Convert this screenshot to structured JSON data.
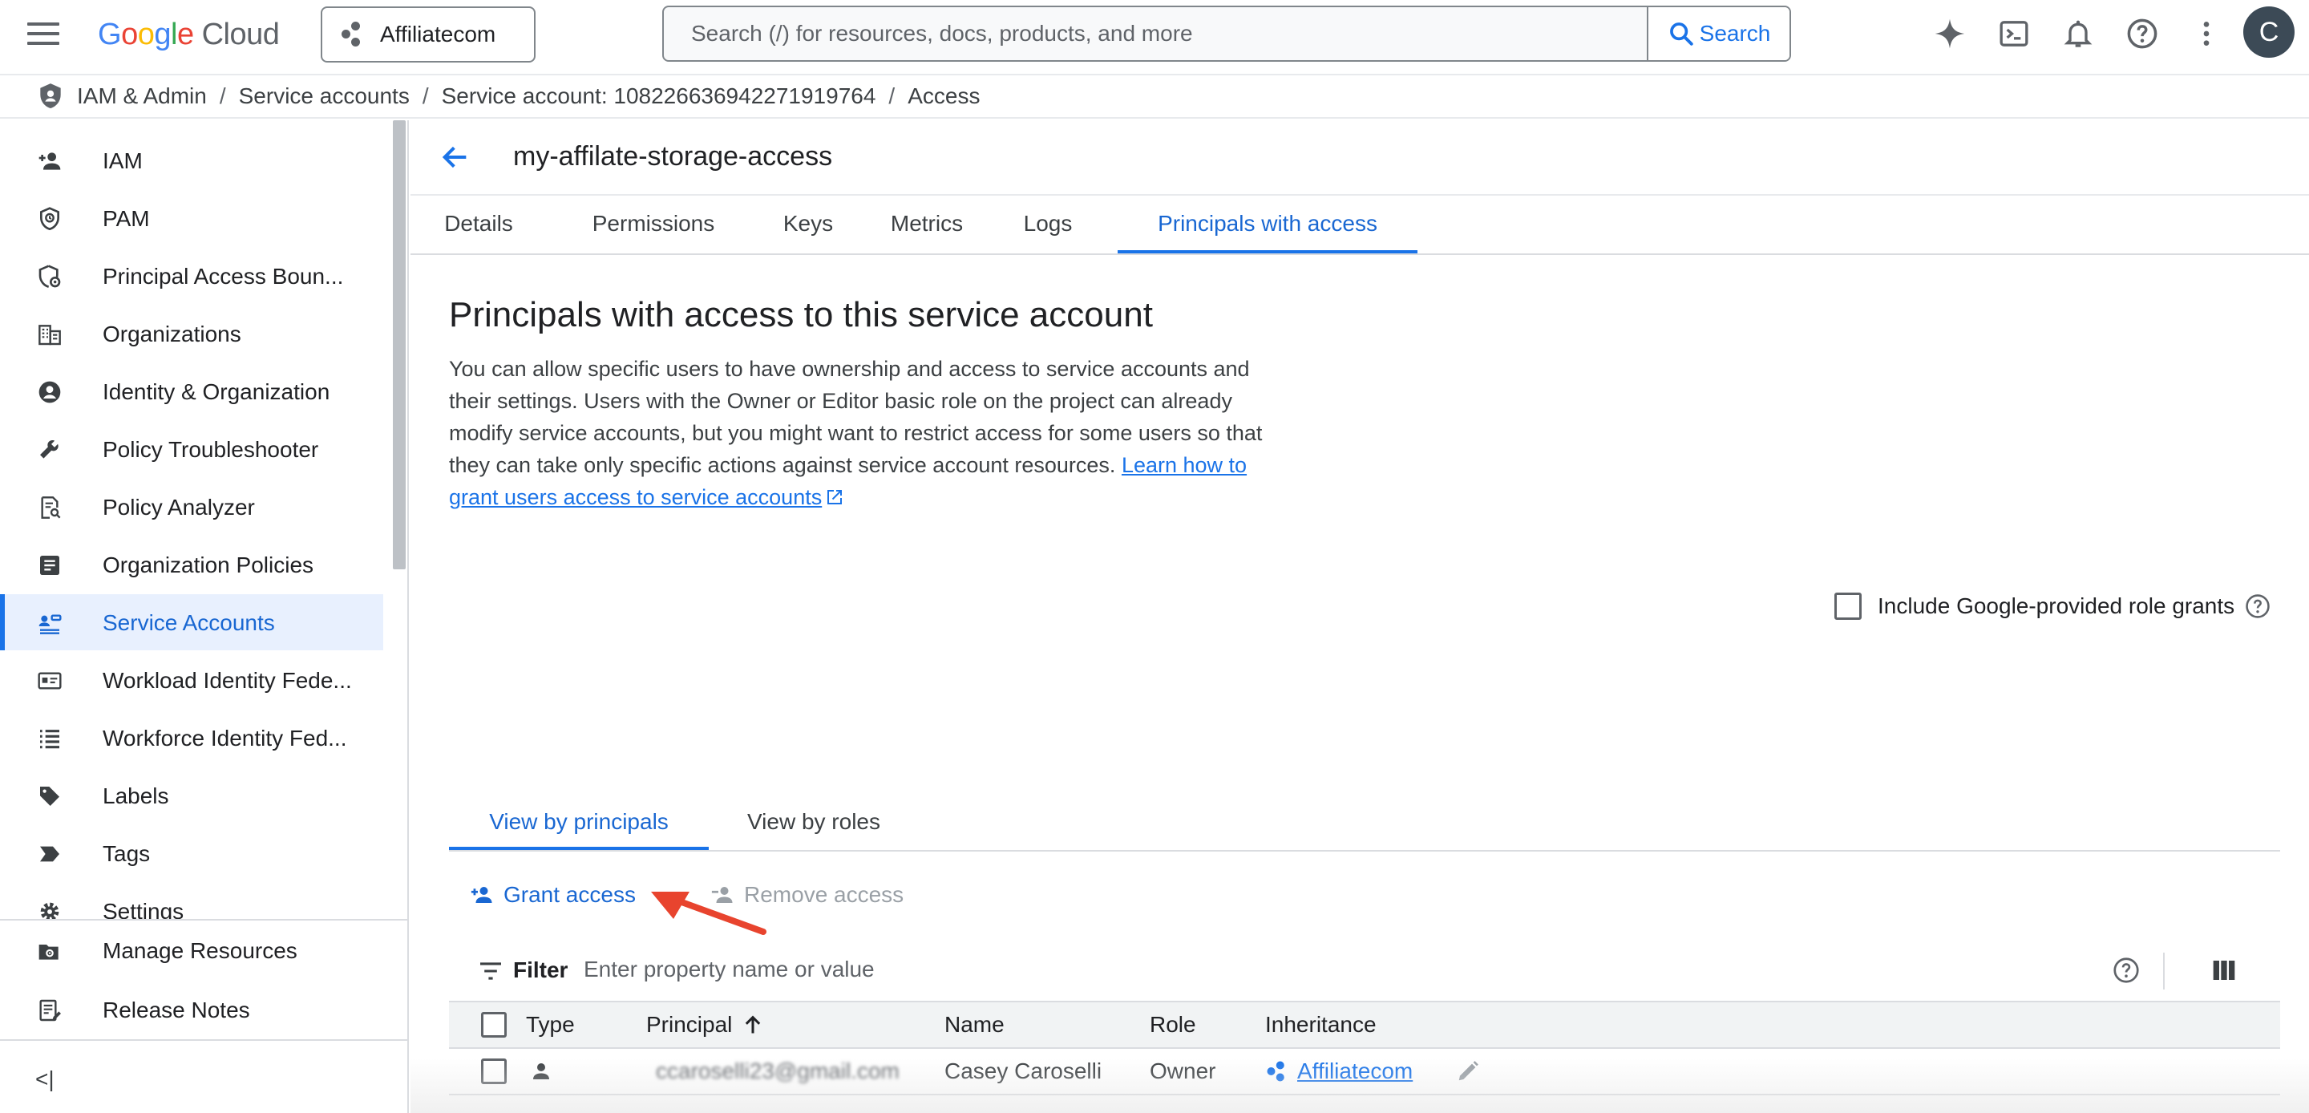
{
  "topbar": {
    "logo": {
      "g1": "G",
      "g2": "o",
      "g3": "o",
      "g4": "g",
      "g5": "l",
      "g6": "e",
      "product": "Cloud"
    },
    "project_name": "Affiliatecom",
    "search_placeholder": "Search (/) for resources, docs, products, and more",
    "search_button": "Search",
    "icons": [
      "gemini-spark-icon",
      "cloud-shell-icon",
      "notifications-icon",
      "help-icon",
      "more-vert-icon"
    ],
    "avatar_initial": "C"
  },
  "breadcrumb": {
    "items": [
      "IAM & Admin",
      "Service accounts",
      "Service account: 108226636942271919764",
      "Access"
    ],
    "separator": "/"
  },
  "sidebar": {
    "items": [
      {
        "label": "IAM",
        "icon": "person-add-icon"
      },
      {
        "label": "PAM",
        "icon": "shield-clock-icon"
      },
      {
        "label": "Principal Access Boun...",
        "icon": "shield-gear-icon"
      },
      {
        "label": "Organizations",
        "icon": "building-icon"
      },
      {
        "label": "Identity & Organization",
        "icon": "account-circle-icon"
      },
      {
        "label": "Policy Troubleshooter",
        "icon": "wrench-icon"
      },
      {
        "label": "Policy Analyzer",
        "icon": "policy-search-icon"
      },
      {
        "label": "Organization Policies",
        "icon": "list-alt-icon"
      },
      {
        "label": "Service Accounts",
        "icon": "service-account-icon"
      },
      {
        "label": "Workload Identity Fede...",
        "icon": "id-card-icon"
      },
      {
        "label": "Workforce Identity Fed...",
        "icon": "list-icon"
      },
      {
        "label": "Labels",
        "icon": "label-icon"
      },
      {
        "label": "Tags",
        "icon": "tag-icon"
      },
      {
        "label": "Settings",
        "icon": "settings-icon"
      }
    ],
    "active_index": 8,
    "bottom": [
      {
        "label": "Manage Resources",
        "icon": "manage-resources-icon"
      },
      {
        "label": "Release Notes",
        "icon": "release-notes-icon"
      }
    ],
    "collapse_label": "<|"
  },
  "main": {
    "service_account_name": "my-affilate-storage-access",
    "tabs": [
      "Details",
      "Permissions",
      "Keys",
      "Metrics",
      "Logs",
      "Principals with access"
    ],
    "active_tab": "Principals with access",
    "heading": "Principals with access to this service account",
    "description": "You can allow specific users to have ownership and access to service accounts and their settings. Users with the Owner or Editor basic role on the project can already modify service accounts, but you might want to restrict access for some users so that they can take only specific actions against service account resources.",
    "learn_link": "Learn how to grant users access to service accounts",
    "include_label": "Include Google-provided role grants",
    "view_tabs": [
      "View by principals",
      "View by roles"
    ],
    "grant_access": "Grant access",
    "remove_access": "Remove access",
    "filter_label": "Filter",
    "filter_placeholder": "Enter property name or value",
    "table": {
      "headers": [
        "Type",
        "Principal",
        "Name",
        "Role",
        "Inheritance"
      ],
      "rows": [
        {
          "type_icon": "person-icon",
          "principal": "ccaroselli23@gmail.com",
          "name": "Casey Caroselli",
          "role": "Owner",
          "inheritance": "Affiliatecom"
        }
      ]
    }
  },
  "colors": {
    "accent": "#1a73e8",
    "active_bg": "#e8f0fe",
    "annotation_arrow": "#e8442e"
  }
}
